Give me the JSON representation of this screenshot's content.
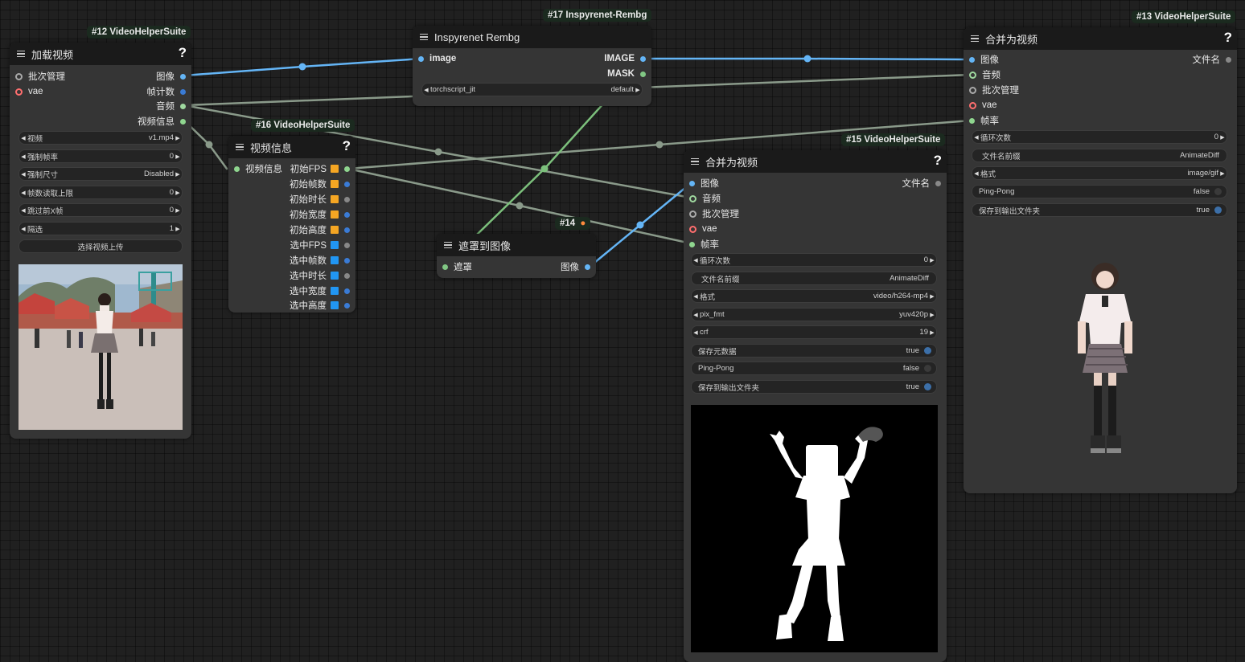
{
  "colors": {
    "image": "#64b5f6",
    "mask": "#81c784",
    "audio": "#9fd89f",
    "float": "#aaaaaa",
    "int": "#6fa8dc",
    "vae": "#ff6e6e",
    "batch": "#aaaaaa",
    "video_info": "#8fd68f",
    "gray_wire": "#8a9a8a"
  },
  "node12": {
    "badge": "#12 VideoHelperSuite",
    "title": "加载视频",
    "help": "?",
    "inputs": [
      "批次管理",
      "vae"
    ],
    "outputs": [
      "图像",
      "帧计数",
      "音频",
      "视频信息"
    ],
    "widgets": [
      {
        "label": "视频",
        "value": "v1.mp4"
      },
      {
        "label": "强制帧率",
        "value": "0"
      },
      {
        "label": "强制尺寸",
        "value": "Disabled"
      },
      {
        "label": "帧数读取上限",
        "value": "0"
      },
      {
        "label": "跳过前X帧",
        "value": "0"
      },
      {
        "label": "隔选",
        "value": "1"
      }
    ],
    "button": "选择视频上传"
  },
  "node16": {
    "badge": "#16 VideoHelperSuite",
    "title": "视频信息",
    "help": "?",
    "inputs": [
      "视频信息"
    ],
    "outputs": [
      "初始FPS",
      "初始帧数",
      "初始时长",
      "初始宽度",
      "初始高度",
      "选中FPS",
      "选中帧数",
      "选中时长",
      "选中宽度",
      "选中高度"
    ]
  },
  "node17": {
    "badge": "#17 Inspyrenet-Rembg",
    "title": "Inspyrenet Rembg",
    "inputs": [
      "image"
    ],
    "outputs": [
      "IMAGE",
      "MASK"
    ],
    "widget": {
      "label": "torchscript_jit",
      "value": "default"
    }
  },
  "node14": {
    "badge": "#14",
    "badge_icon": "fox-icon",
    "title": "遮罩到图像",
    "inputs": [
      "遮罩"
    ],
    "outputs": [
      "图像"
    ]
  },
  "node15": {
    "badge": "#15 VideoHelperSuite",
    "title": "合并为视频",
    "help": "?",
    "inputs": [
      "图像",
      "音频",
      "批次管理",
      "vae",
      "帧率"
    ],
    "outputs": [
      "文件名"
    ],
    "widgets": [
      {
        "label": "循环次数",
        "value": "0",
        "kind": "number"
      },
      {
        "label": "文件名前缀",
        "value": "AnimateDiff",
        "kind": "text"
      },
      {
        "label": "格式",
        "value": "video/h264-mp4",
        "kind": "combo"
      },
      {
        "label": "pix_fmt",
        "value": "yuv420p",
        "kind": "combo"
      },
      {
        "label": "crf",
        "value": "19",
        "kind": "number"
      },
      {
        "label": "保存元数据",
        "value": "true",
        "kind": "toggle"
      },
      {
        "label": "Ping-Pong",
        "value": "false",
        "kind": "toggle"
      },
      {
        "label": "保存到输出文件夹",
        "value": "true",
        "kind": "toggle"
      }
    ]
  },
  "node13": {
    "badge": "#13 VideoHelperSuite",
    "title": "合并为视频",
    "help": "?",
    "inputs": [
      "图像",
      "音频",
      "批次管理",
      "vae",
      "帧率"
    ],
    "outputs": [
      "文件名"
    ],
    "widgets": [
      {
        "label": "循环次数",
        "value": "0",
        "kind": "number"
      },
      {
        "label": "文件名前缀",
        "value": "AnimateDiff",
        "kind": "text"
      },
      {
        "label": "格式",
        "value": "image/gif",
        "kind": "combo"
      },
      {
        "label": "Ping-Pong",
        "value": "false",
        "kind": "toggle"
      },
      {
        "label": "保存到输出文件夹",
        "value": "true",
        "kind": "toggle"
      }
    ]
  }
}
